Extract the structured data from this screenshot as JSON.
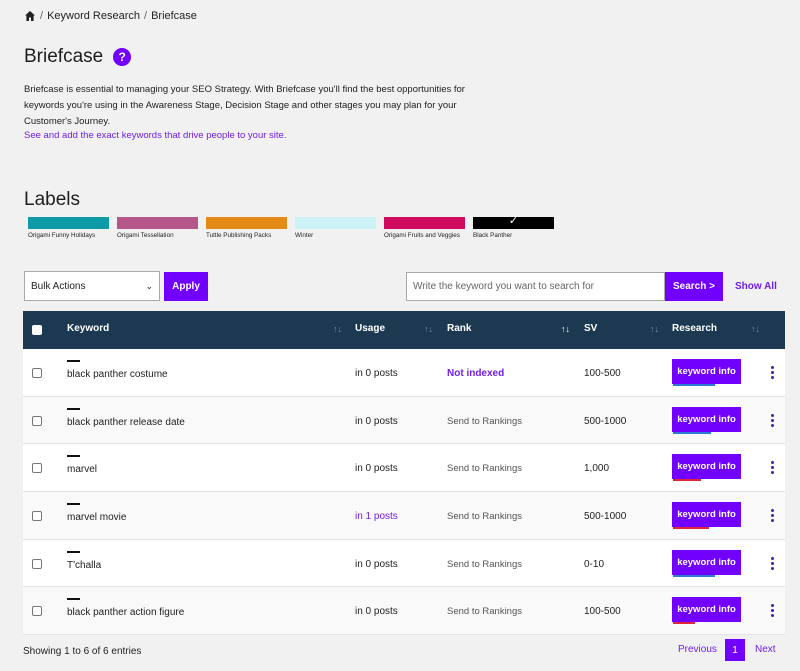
{
  "breadcrumb": {
    "items": [
      "Keyword Research",
      "Briefcase"
    ],
    "separator": "/"
  },
  "page": {
    "title": "Briefcase",
    "help_icon": "?",
    "description": "Briefcase is essential to managing your SEO Strategy. With Briefcase you'll find the best opportunities for keywords you're using in the Awareness Stage, Decision Stage and other stages you may plan for your Customer's Journey.",
    "link": "See and add the exact keywords that drive people to your site."
  },
  "labels": {
    "title": "Labels",
    "items": [
      {
        "name": "Origami Funny Holidays",
        "color": "#0e9aa7",
        "selected": false
      },
      {
        "name": "Origami Tessellation",
        "color": "#b5578b",
        "selected": false
      },
      {
        "name": "Tuttle Publishing Packs",
        "color": "#e48a17",
        "selected": false
      },
      {
        "name": "Winter",
        "color": "#cdf2f5",
        "selected": false
      },
      {
        "name": "Origami Fruits and Veggies",
        "color": "#cf0a5f",
        "selected": false
      },
      {
        "name": "Black Panther",
        "color": "#000000",
        "selected": true
      }
    ]
  },
  "toolbar": {
    "bulk_actions": "Bulk Actions",
    "apply": "Apply",
    "search_placeholder": "Write the keyword you want to search for",
    "search_button": "Search >",
    "show_all": "Show All"
  },
  "table": {
    "headers": {
      "keyword": "Keyword",
      "usage": "Usage",
      "rank": "Rank",
      "sv": "SV",
      "research": "Research"
    },
    "research_button": "keyword info",
    "rows": [
      {
        "keyword": "black panther costume",
        "usage": "in 0 posts",
        "rank": "Not indexed",
        "sv": "100-500",
        "bar_color": "#2b7bd6",
        "bar_width": 42
      },
      {
        "keyword": "black panther release date",
        "usage": "in 0 posts",
        "rank": "Send to Rankings",
        "sv": "500-1000",
        "bar_color": "#2b7bd6",
        "bar_width": 38
      },
      {
        "keyword": "marvel",
        "usage": "in 0 posts",
        "rank": "Send to Rankings",
        "sv": "1,000",
        "bar_color": "#e0243a",
        "bar_width": 28
      },
      {
        "keyword": "marvel movie",
        "usage": "in 1 posts",
        "rank": "Send to Rankings",
        "sv": "500-1000",
        "bar_color": "#e0243a",
        "bar_width": 36
      },
      {
        "keyword": "T'challa",
        "usage": "in 0 posts",
        "rank": "Send to Rankings",
        "sv": "0-10",
        "bar_color": "#2b7bd6",
        "bar_width": 42
      },
      {
        "keyword": "black panther action figure",
        "usage": "in 0 posts",
        "rank": "Send to Rankings",
        "sv": "100-500",
        "bar_color": "#e0243a",
        "bar_width": 22
      }
    ]
  },
  "footer": {
    "info": "Showing 1 to 6 of 6 entries",
    "previous": "Previous",
    "page": "1",
    "next": "Next"
  }
}
